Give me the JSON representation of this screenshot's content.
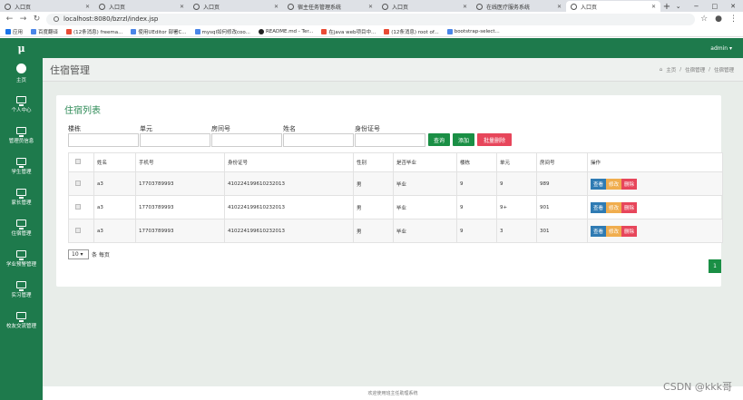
{
  "browser": {
    "tabs": [
      {
        "title": "入口页",
        "active": false
      },
      {
        "title": "入口页",
        "active": false
      },
      {
        "title": "入口页",
        "active": false
      },
      {
        "title": "宿主任务管理系统",
        "active": false
      },
      {
        "title": "入口页",
        "active": false
      },
      {
        "title": "在线医疗服务系统",
        "active": false
      },
      {
        "title": "入口页",
        "active": true
      }
    ],
    "url": "localhost:8080/bzrzl/index.jsp",
    "bookmarks": [
      "应用",
      "百度翻译",
      "(12条消息) freema...",
      "使用UEditor 部署C...",
      "mysql如何修改coo...",
      "README.md - Ter...",
      "在java web项目中...",
      "(12条消息) root of...",
      "bootstrap-select..."
    ]
  },
  "app": {
    "logo": "μ",
    "user": "admin ▾",
    "nav": [
      "主页",
      "个人中心",
      "管理员信息",
      "学生管理",
      "家长管理",
      "住宿管理",
      "学业预警管理",
      "实习管理",
      "校友交流管理"
    ],
    "page_title": "住宿管理",
    "breadcrumb": [
      "主页",
      "住宿管理",
      "住宿管理"
    ],
    "list_title": "住宿列表",
    "filters": [
      "楼栋",
      "单元",
      "房间号",
      "姓名",
      "身份证号"
    ],
    "buttons": {
      "search": "查询",
      "add": "添加",
      "batch_delete": "批量删除"
    },
    "table": {
      "headers": [
        "",
        "姓名",
        "手机号",
        "身份证号",
        "性别",
        "是否毕业",
        "楼栋",
        "单元",
        "房间号",
        "操作"
      ],
      "rows": [
        [
          "",
          "a3",
          "17703789993",
          "410224199610232013",
          "男",
          "毕业",
          "9",
          "9",
          "989"
        ],
        [
          "",
          "a3",
          "17703789993",
          "410224199610232013",
          "男",
          "毕业",
          "9",
          "9+",
          "901"
        ],
        [
          "",
          "a3",
          "17703789993",
          "410224199610232013",
          "男",
          "毕业",
          "9",
          "3",
          "301"
        ]
      ],
      "actions": [
        "查看",
        "修改",
        "删除"
      ]
    },
    "page_size": "10 ▾",
    "page_size_suffix": "条 每页",
    "current_page": "1",
    "footer": "欢迎使用班主任助理系统"
  },
  "watermark": "CSDN @kkk哥"
}
